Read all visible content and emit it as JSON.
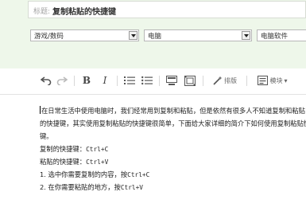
{
  "title_field": {
    "prefix": "标题:",
    "value": "复制粘贴的快捷键"
  },
  "selects": [
    {
      "value": "游戏/数码"
    },
    {
      "value": "电脑"
    },
    {
      "value": "电脑软件"
    }
  ],
  "toolbar": {
    "typeset_label": "排版",
    "module_label": "模块"
  },
  "content": {
    "lines": [
      "在日常生活中使用电脑时，我们经常用到复制和粘贴，但是依然有很多人不知道复制和粘贴",
      "的快捷键，其实使用复制粘贴的快捷键很简单，下面给大家详细的简介下如何使用复制粘贴快捷",
      "键。"
    ],
    "copy_label": "复制的快捷键：",
    "copy_key": "Ctrl+C",
    "paste_label": "粘贴的快捷键：",
    "paste_key": "Ctrl+V",
    "step1_text": "1. 选中你需要复制的内容，按",
    "step1_key": "Ctrl+C",
    "step2_text": "2. 在你需要粘贴的地方，按",
    "step2_key": "Ctrl+V"
  }
}
